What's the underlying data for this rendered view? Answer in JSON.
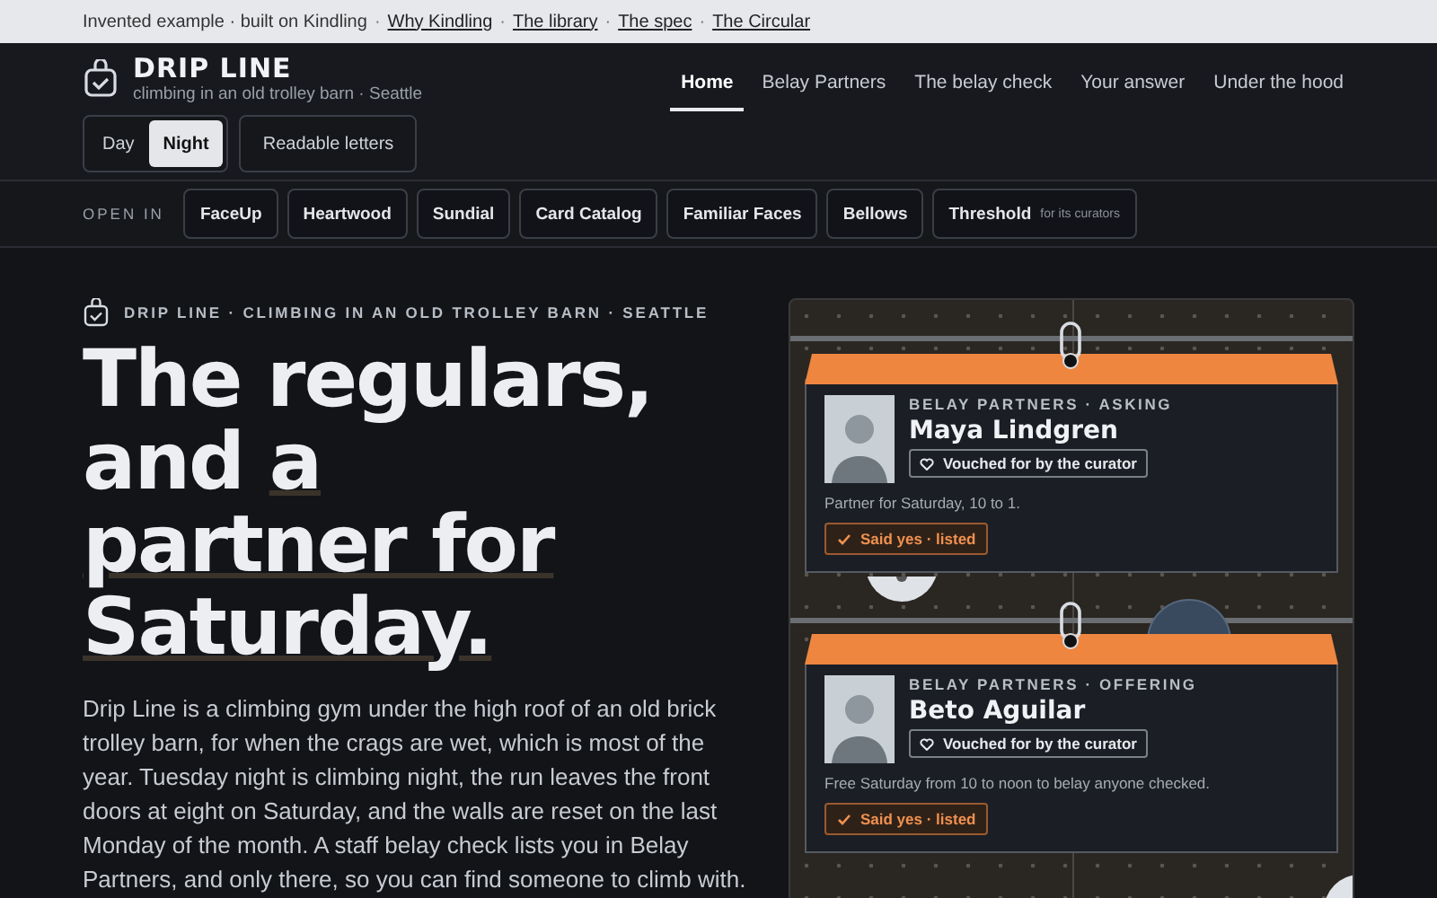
{
  "strip": {
    "note": "Invented example · built on Kindling",
    "separator": "·",
    "links": [
      "Why Kindling",
      "The library",
      "The spec",
      "The Circular"
    ]
  },
  "brand": {
    "title": "DRIP LINE",
    "subtitle": "climbing in an old trolley barn · Seattle"
  },
  "nav": [
    {
      "label": "Home",
      "selected": true
    },
    {
      "label": "Belay Partners",
      "selected": false
    },
    {
      "label": "The belay check",
      "selected": false
    },
    {
      "label": "Your answer",
      "selected": false
    },
    {
      "label": "Under the hood",
      "selected": false
    }
  ],
  "theme": [
    {
      "label": "Day",
      "selected": false
    },
    {
      "label": "Night",
      "selected": true
    }
  ],
  "readable_button": "Readable letters",
  "open_in": {
    "label": "OPEN IN",
    "apps": [
      {
        "label": "FaceUp"
      },
      {
        "label": "Heartwood"
      },
      {
        "label": "Sundial"
      },
      {
        "label": "Card Catalog"
      },
      {
        "label": "Familiar Faces"
      },
      {
        "label": "Bellows"
      },
      {
        "label": "Threshold",
        "note": "for its curators"
      }
    ]
  },
  "hero": {
    "eyebrow": "DRIP LINE · CLIMBING IN AN OLD TROLLEY BARN · SEATTLE",
    "headline": [
      {
        "parts": [
          {
            "text": "The regulars,",
            "marked": false
          }
        ]
      },
      {
        "parts": [
          {
            "text": "and ",
            "marked": false
          },
          {
            "text": "a",
            "marked": true
          }
        ]
      },
      {
        "parts": [
          {
            "text": "partner for",
            "marked": true
          }
        ]
      },
      {
        "parts": [
          {
            "text": "Saturday.",
            "marked": true
          }
        ]
      }
    ],
    "body": "Drip Line is a climbing gym under the high roof of an old brick trolley barn, for when the crags are wet, which is most of the year. Tuesday night is climbing night, the run leaves the front doors at eight on Saturday, and the walls are reset on the last Monday of the month. A staff belay check lists you in Belay Partners, and only there, so you can find someone to climb with."
  },
  "cards": [
    {
      "eyebrow": "BELAY PARTNERS · ASKING",
      "name": "Maya Lindgren",
      "badge": "Vouched for by the curator",
      "text": "Partner for Saturday, 10 to 1.",
      "status": "Said yes · listed"
    },
    {
      "eyebrow": "BELAY PARTNERS · OFFERING",
      "name": "Beto Aguilar",
      "badge": "Vouched for by the curator",
      "text": "Free Saturday from 10 to noon to belay anyone checked.",
      "status": "Said yes · listed"
    }
  ]
}
